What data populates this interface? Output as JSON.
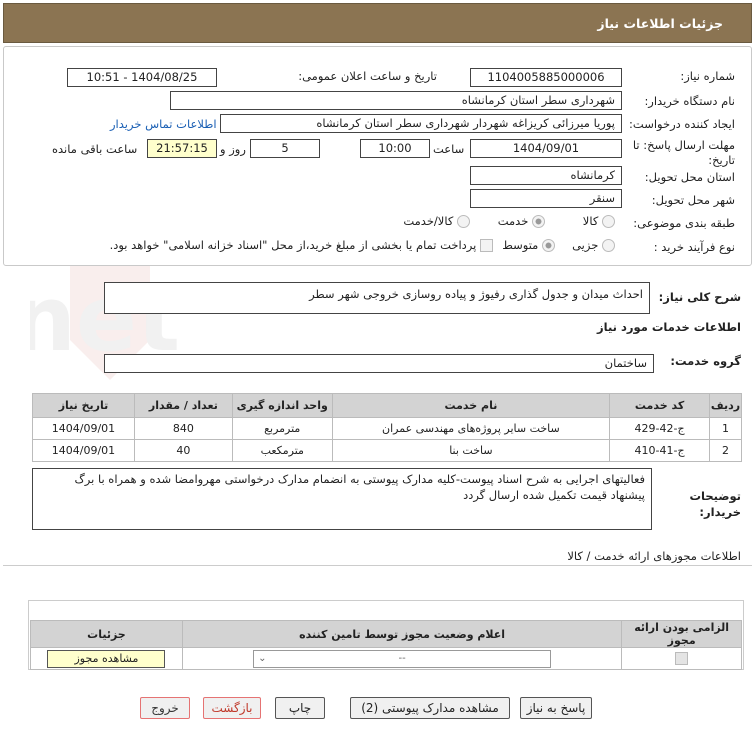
{
  "header": {
    "title": "جزئیات اطلاعات نیاز"
  },
  "fields": {
    "need_no_label": "شماره نیاز:",
    "need_no": "1104005885000006",
    "announce_label": "تاریخ و ساعت اعلان عمومی:",
    "announce": "1404/08/25 - 10:51",
    "buyer_label": "نام دستگاه خریدار:",
    "buyer": "شهرداری سطر استان کرمانشاه",
    "creator_label": "ایجاد کننده درخواست:",
    "creator": "پوریا میرزائی کریزاغه شهردار شهرداری سطر استان کرمانشاه",
    "contact_link": "اطلاعات تماس خریدار",
    "deadline_label": "مهلت ارسال پاسخ: تا تاریخ:",
    "deadline_date": "1404/09/01",
    "time_label": "ساعت",
    "deadline_time": "10:00",
    "days": "5",
    "days_label": "روز و",
    "remaining": "21:57:15",
    "remaining_label": "ساعت باقی مانده",
    "province_label": "استان محل تحویل:",
    "province": "کرمانشاه",
    "city_label": "شهر محل تحویل:",
    "city": "سنقر",
    "category_label": "طبقه بندی موضوعی:",
    "cat_goods": "کالا",
    "cat_service": "خدمت",
    "cat_both": "کالا/خدمت",
    "process_label": "نوع فرآیند خرید :",
    "proc_small": "جزیی",
    "proc_medium": "متوسط",
    "payment_note": "پرداخت تمام یا بخشی از مبلغ خرید،از محل \"اسناد خزانه اسلامی\" خواهد بود."
  },
  "summary": {
    "label": "شرح کلی نیاز:",
    "text": "احداث میدان و جدول گذاری رفیوژ و پیاده روسازی خروجی شهر سطر"
  },
  "services_info_title": "اطلاعات خدمات مورد نیاز",
  "service_group": {
    "label": "گروه خدمت:",
    "value": "ساختمان"
  },
  "table": {
    "headers": [
      "ردیف",
      "کد خدمت",
      "نام خدمت",
      "واحد اندازه گیری",
      "تعداد / مقدار",
      "تاریخ نیاز"
    ],
    "rows": [
      [
        "1",
        "ج-42-429",
        "ساخت سایر پروژه‌های مهندسی عمران",
        "مترمربع",
        "840",
        "1404/09/01"
      ],
      [
        "2",
        "ج-41-410",
        "ساخت بنا",
        "مترمکعب",
        "40",
        "1404/09/01"
      ]
    ]
  },
  "buyer_notes": {
    "label": "توضیحات خریدار:",
    "text": "فعالیتهای اجرایی به شرح اسناد پیوست-کلیه مدارک پیوستی به انضمام مدارک درخواستی مهروامضا شده و همراه با برگ پیشنهاد قیمت تکمیل شده ارسال گردد"
  },
  "permits": {
    "title": "اطلاعات مجوزهای ارائه خدمت / کالا",
    "headers": [
      "الزامی بودن ارائه مجوز",
      "اعلام وضعیت مجوز توسط تامین کننده",
      "جزئیات"
    ],
    "select_value": "--",
    "view_button": "مشاهده مجوز"
  },
  "buttons": {
    "reply": "پاسخ به نیاز",
    "attachments": "مشاهده مدارک پیوستی (2)",
    "print": "چاپ",
    "back": "بازگشت",
    "exit": "خروج"
  },
  "watermark": "AriaTender.net"
}
